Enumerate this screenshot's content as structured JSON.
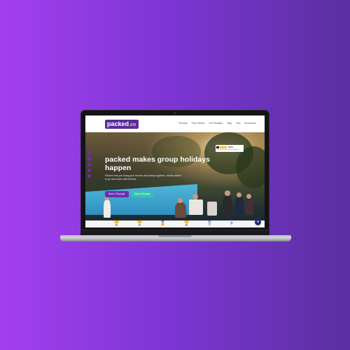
{
  "brand": {
    "logo_main": "packed",
    "logo_suffix": ".co"
  },
  "nav": {
    "items": [
      "Recently",
      "How it Works",
      "Our Packages",
      "Blog",
      "Help",
      "My Account"
    ]
  },
  "hero": {
    "headline": "packed makes group holidays happen",
    "subtext": "Packed lets you bring your friends and family together, decide where to go and share with friends.",
    "primary_button": "Start a Trip page",
    "secondary_button": "Start a Package"
  },
  "review_badge": {
    "title": "feefo",
    "caption": "Platinum Trusted Service Award"
  },
  "icon_bar": {
    "icons": [
      "trophy-gold-icon",
      "trophy-bronze-icon",
      "medal-icon",
      "trophy-icon",
      "award-icon",
      "plane-icon"
    ]
  },
  "colors": {
    "background_start": "#a33ff0",
    "background_end": "#5a2fa0",
    "brand_purple": "#5b2a9e",
    "accent_teal": "#37c1b3"
  }
}
